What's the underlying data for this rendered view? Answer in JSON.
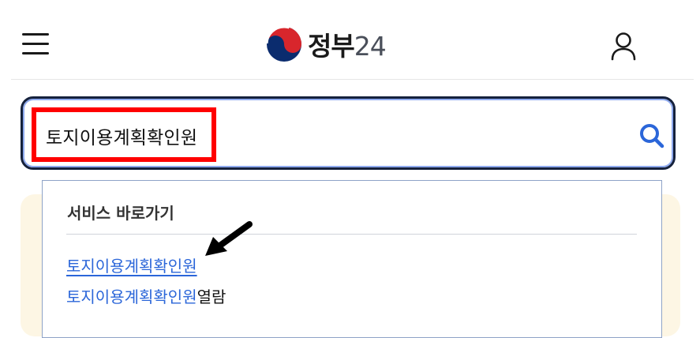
{
  "header": {
    "logo_text": "정부",
    "logo_number": "24"
  },
  "search": {
    "query": "토지이용계획확인원"
  },
  "dropdown": {
    "section_title": "서비스 바로가기",
    "items": [
      {
        "highlight": "토지이용계획확인원",
        "rest": ""
      },
      {
        "highlight": "토지이용계획확인원",
        "rest": "열람"
      }
    ]
  },
  "colors": {
    "accent": "#2b66d9",
    "search_border": "#15213c",
    "annotation_box": "#ff0000",
    "panel_bg": "#fdf6e4"
  }
}
